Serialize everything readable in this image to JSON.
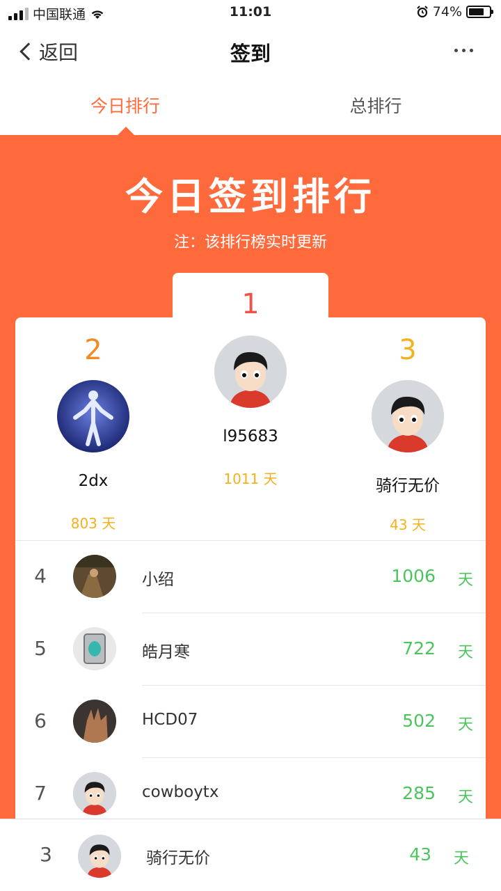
{
  "status_bar": {
    "carrier": "中国联通",
    "time": "11:01",
    "battery": "74%",
    "battery_level": 0.74
  },
  "nav": {
    "back_label": "返回",
    "title": "签到"
  },
  "tabs": [
    {
      "label": "今日排行",
      "active": true
    },
    {
      "label": "总排行",
      "active": false
    }
  ],
  "banner": {
    "title": "今日签到排行",
    "note": "注：该排行榜实时更新"
  },
  "podium": {
    "first": {
      "rank": "1",
      "name": "l95683",
      "days": "1011 天",
      "avatar": "cartoon-boy-avatar"
    },
    "second": {
      "rank": "2",
      "name": "2dx",
      "days": "803 天",
      "avatar": "glowing-figure-avatar"
    },
    "third": {
      "rank": "3",
      "name": "骑行无价",
      "days": "43 天",
      "avatar": "cartoon-boy-avatar"
    }
  },
  "list": [
    {
      "rank": "4",
      "name": "小绍",
      "days": "1006",
      "unit": "天",
      "avatar": "photo-avatar"
    },
    {
      "rank": "5",
      "name": "皓月寒",
      "days": "722",
      "unit": "天",
      "avatar": "photo-avatar"
    },
    {
      "rank": "6",
      "name": "HCD07",
      "days": "502",
      "unit": "天",
      "avatar": "photo-avatar"
    },
    {
      "rank": "7",
      "name": "cowboytx",
      "days": "285",
      "unit": "天",
      "avatar": "cartoon-boy-avatar"
    }
  ],
  "my_rank": {
    "rank": "3",
    "name": "骑行无价",
    "days": "43",
    "unit": "天",
    "avatar": "cartoon-boy-avatar"
  },
  "colors": {
    "accent": "#ff6a3c",
    "gold": "#f5b01d",
    "green": "#4cc45c",
    "rank1": "#f0524a",
    "rank2": "#f28a22",
    "rank3": "#f5b01d"
  }
}
